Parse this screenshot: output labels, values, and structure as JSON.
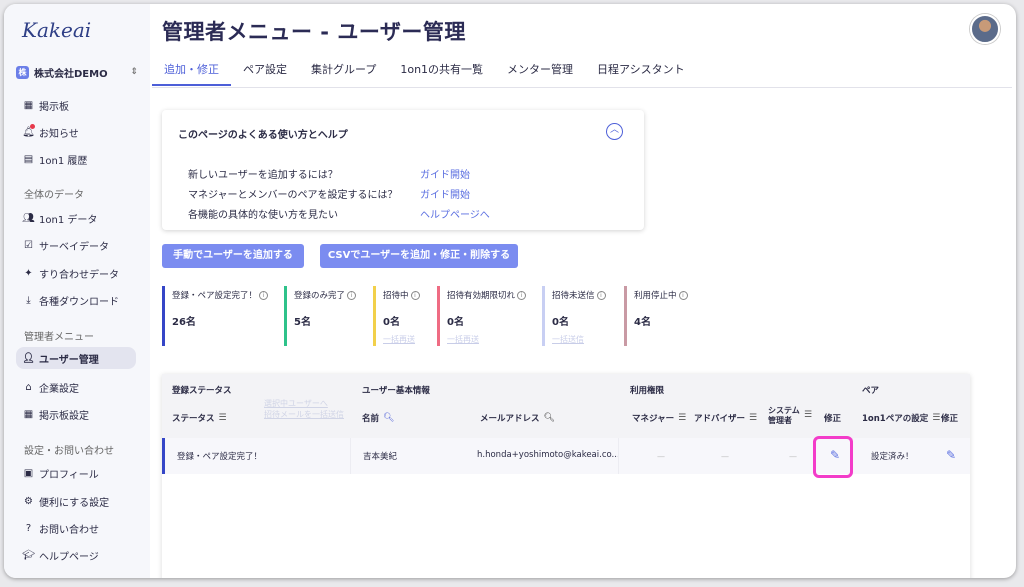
{
  "app": {
    "logo": "Kakeai",
    "company": "株式会社DEMO",
    "company_badge": "株"
  },
  "sidebar": {
    "top_items": [
      {
        "label": "掲示板",
        "icon": "board-icon"
      },
      {
        "label": "お知らせ",
        "icon": "bell-icon"
      },
      {
        "label": "1on1 履歴",
        "icon": "history-icon"
      }
    ],
    "section_data": "全体のデータ",
    "data_items": [
      {
        "label": "1on1 データ",
        "icon": "people-icon"
      },
      {
        "label": "サーベイデータ",
        "icon": "survey-icon"
      },
      {
        "label": "すり合わせデータ",
        "icon": "puzzle-icon"
      },
      {
        "label": "各種ダウンロード",
        "icon": "download-icon"
      }
    ],
    "section_admin": "管理者メニュー",
    "admin_items": [
      {
        "label": "ユーザー管理",
        "icon": "user-admin-icon"
      },
      {
        "label": "企業設定",
        "icon": "company-icon"
      },
      {
        "label": "掲示板設定",
        "icon": "board-settings-icon"
      }
    ],
    "section_settings": "設定・お問い合わせ",
    "settings_items": [
      {
        "label": "プロフィール",
        "icon": "profile-icon"
      },
      {
        "label": "便利にする設定",
        "icon": "gear-icon"
      },
      {
        "label": "お問い合わせ",
        "icon": "question-icon"
      },
      {
        "label": "ヘルプページ",
        "icon": "help-icon"
      }
    ]
  },
  "header": {
    "title": "管理者メニュー - ユーザー管理"
  },
  "tabs": [
    "追加・修正",
    "ペア設定",
    "集計グループ",
    "1on1の共有一覧",
    "メンター管理",
    "日程アシスタント"
  ],
  "help": {
    "title": "このページのよくある使い方とヘルプ",
    "items": [
      {
        "q": "新しいユーザーを追加するには？",
        "link": "ガイド開始"
      },
      {
        "q": "マネジャーとメンバーのペアを設定するには？",
        "link": "ガイド開始"
      },
      {
        "q": "各機能の具体的な使い方を見たい",
        "link": "ヘルプページへ"
      }
    ]
  },
  "buttons": {
    "add_manual": "手動でユーザーを追加する",
    "csv": "CSVでユーザーを追加・修正・削除する"
  },
  "stats": [
    {
      "label": "登録・ペア設定完了！",
      "value": "26名",
      "sub": "",
      "color": "#3546c7"
    },
    {
      "label": "登録のみ完了",
      "value": "5名",
      "sub": "",
      "color": "#2ec28a"
    },
    {
      "label": "招待中",
      "value": "0名",
      "sub": "一括再送",
      "color": "#f2d04a"
    },
    {
      "label": "招待有効期限切れ",
      "value": "0名",
      "sub": "一括再送",
      "color": "#ef6c83"
    },
    {
      "label": "招待未送信",
      "value": "0名",
      "sub": "一括送信",
      "color": "#c8cff3"
    },
    {
      "label": "利用停止中",
      "value": "4名",
      "sub": "",
      "color": "#c99aa4"
    }
  ],
  "table": {
    "groups": {
      "status": "登録ステータス",
      "basic": "ユーザー基本情報",
      "perm": "利用権限",
      "pair": "ペア"
    },
    "faded_links": [
      "選択中ユーザーへ",
      "招待メールを一括送信"
    ],
    "columns": {
      "status": "ステータス",
      "name": "名前",
      "email": "メールアドレス",
      "manager": "マネジャー",
      "advisor": "アドバイザー",
      "sys1": "システム",
      "sys2": "管理者",
      "edit": "修正",
      "pair": "1on1ペアの設定",
      "pair_edit": "修正"
    },
    "rows": [
      {
        "status": "登録・ペア設定完了！",
        "name": "吉本美紀",
        "email": "h.honda+yoshimoto@kakeai.co...",
        "manager": "—",
        "advisor": "—",
        "sys": "—",
        "pair": "設定済み！"
      }
    ]
  }
}
